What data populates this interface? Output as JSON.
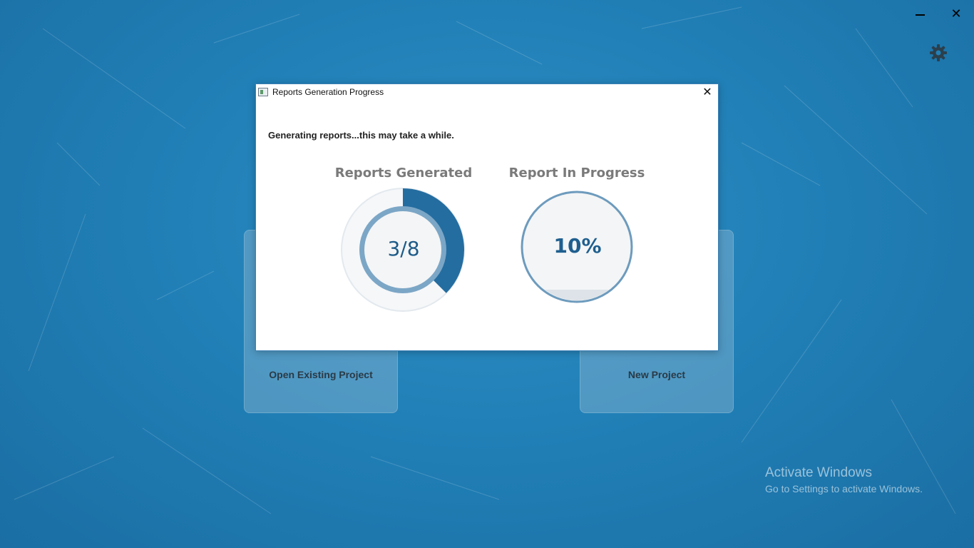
{
  "window_controls": {
    "minimize_icon": "minimize-icon",
    "close_glyph": "✕"
  },
  "settings": {
    "icon": "gear-icon"
  },
  "tiles": [
    {
      "label": "Open Existing Project"
    },
    {
      "label": "New Project"
    }
  ],
  "dialog": {
    "title": "Reports Generation Progress",
    "close_glyph": "✕",
    "message": "Generating reports...this may take a while.",
    "reports_generated": {
      "title": "Reports Generated",
      "value_text": "3/8",
      "completed": 3,
      "total": 8
    },
    "report_in_progress": {
      "title": "Report In Progress",
      "value_text": "10%",
      "percent": 10
    }
  },
  "watermark": {
    "title": "Activate Windows",
    "subtitle": "Go to Settings to activate Windows."
  },
  "colors": {
    "background": "#2180b7",
    "gauge_dark": "#246da0",
    "gauge_ring": "#7ca6c6",
    "gauge_text": "#1d5b88"
  }
}
